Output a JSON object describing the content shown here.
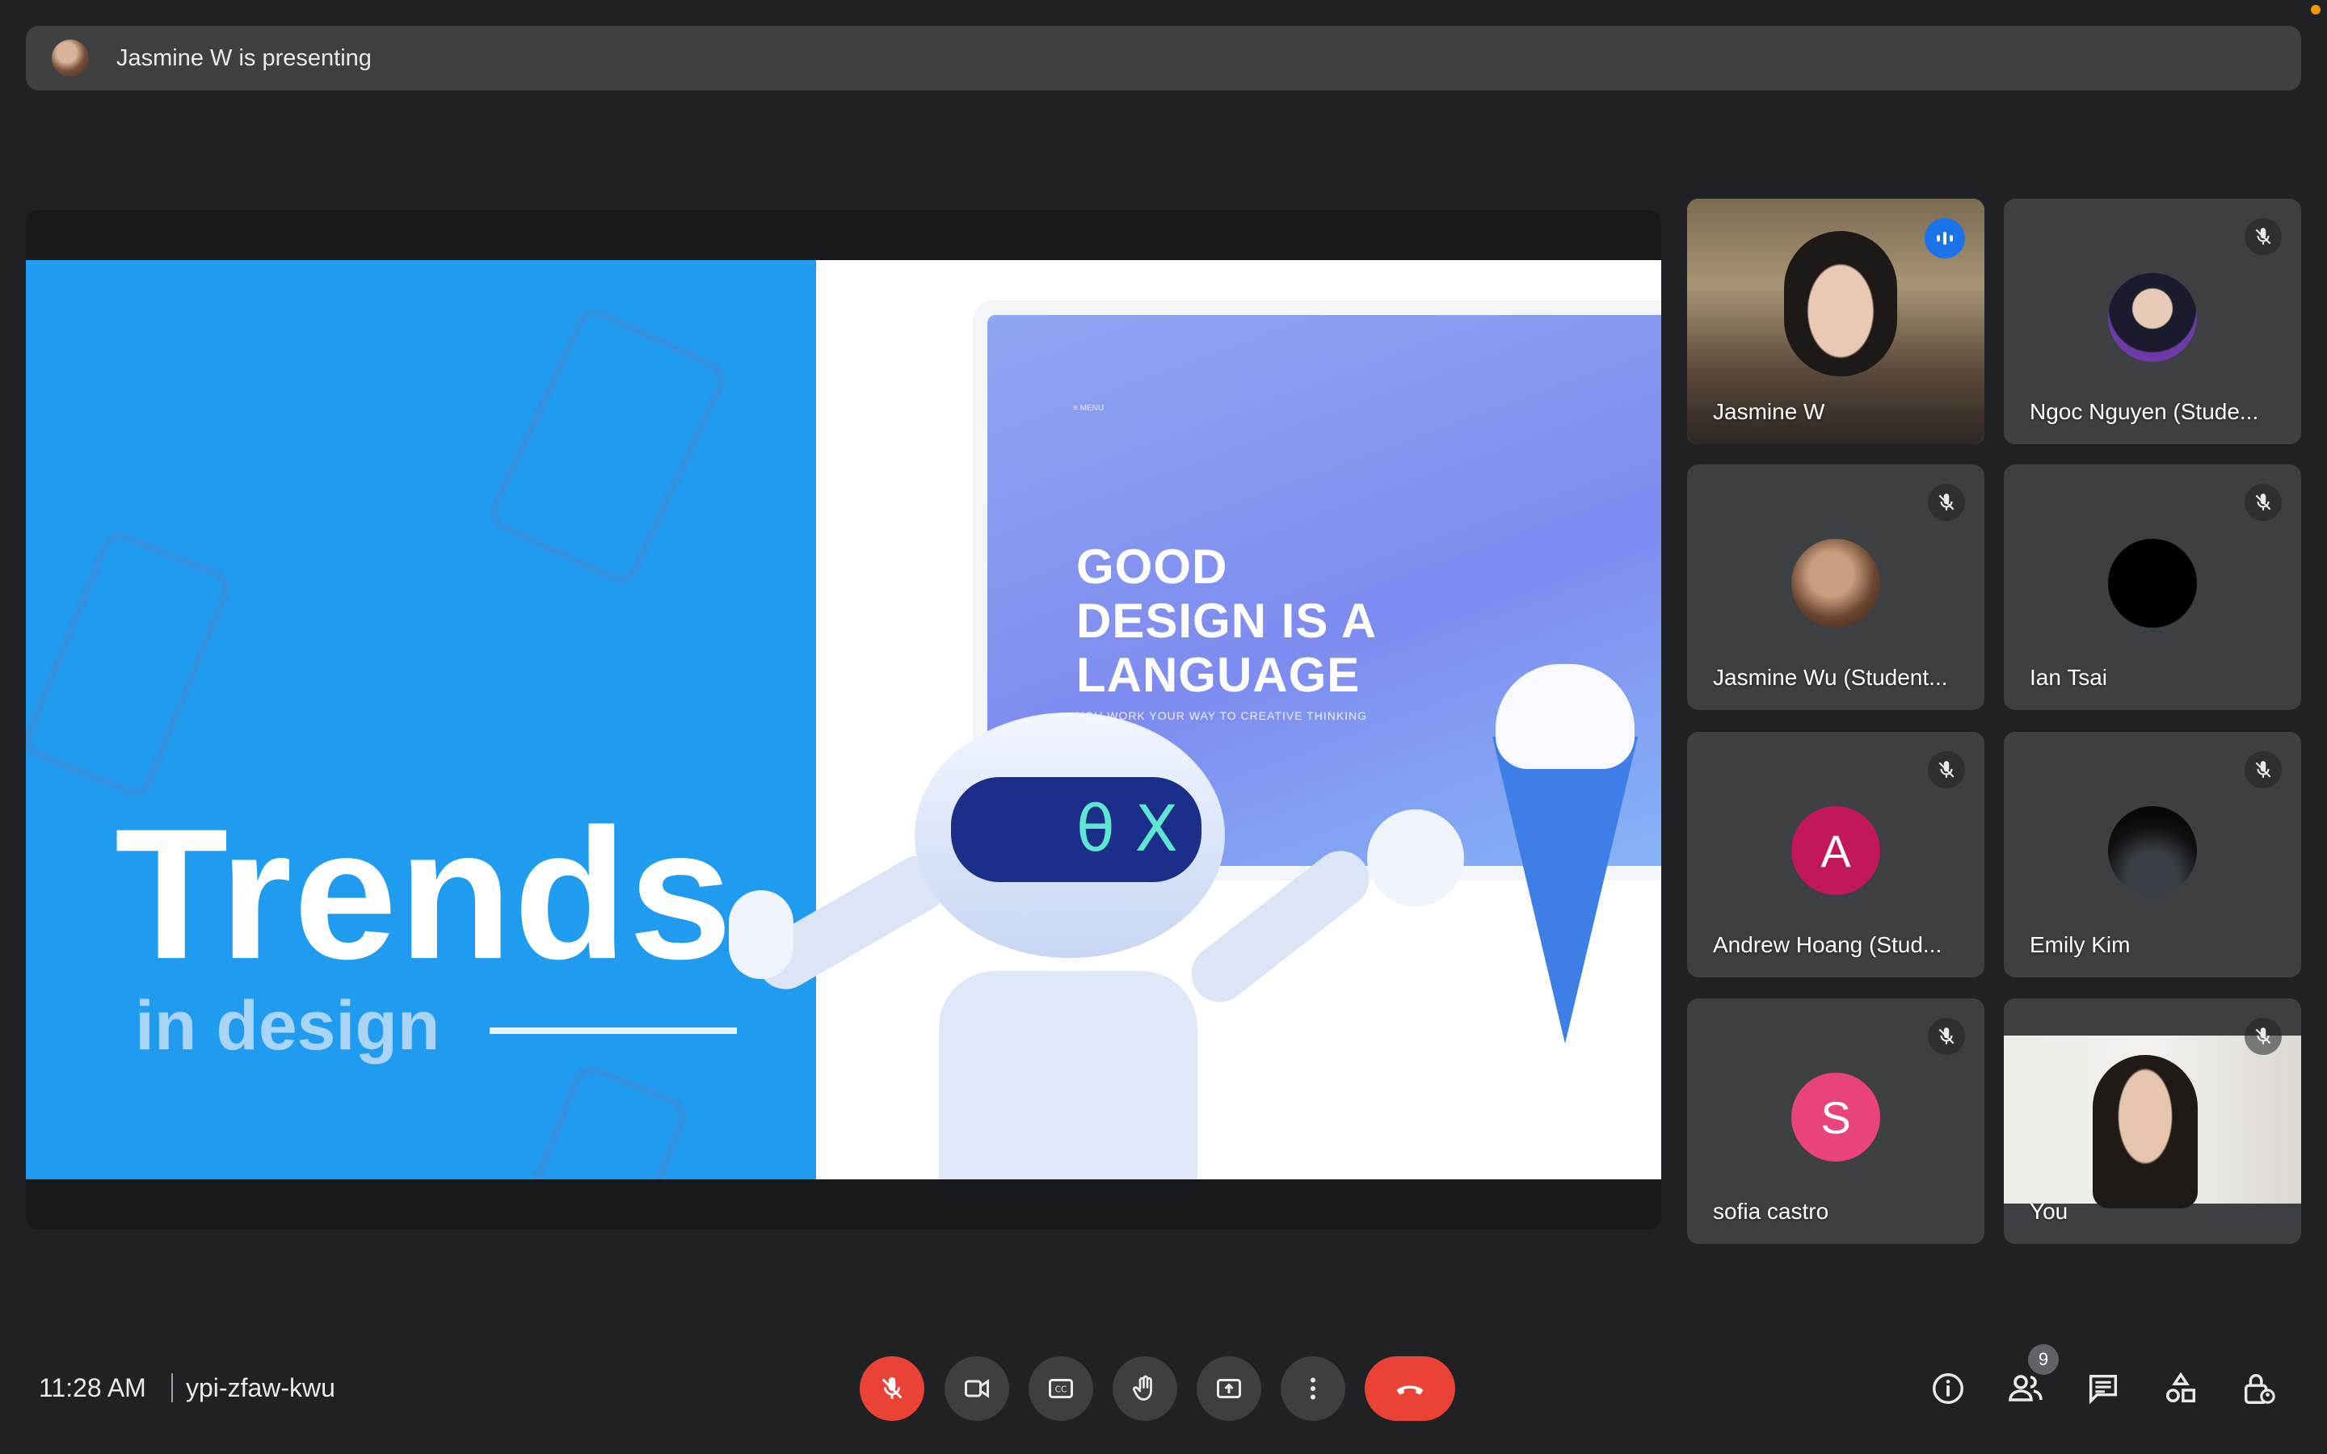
{
  "banner": {
    "text": "Jasmine W is presenting"
  },
  "slide": {
    "title": "Trends",
    "subtitle": "in design",
    "mock_menu": "≡ MENU",
    "mock_heading_lines": [
      "GOOD",
      "DESIGN IS A",
      "LANGUAGE"
    ],
    "mock_tagline": "YOU WORK YOUR WAY TO CREATIVE THINKING",
    "robot_eyes": "θ X",
    "colors": {
      "left_bg": "#1f9bf0",
      "screen": "#8fa6f1"
    }
  },
  "participants": [
    {
      "name": "Jasmine W",
      "speaking": true,
      "muted": false,
      "kind": "video"
    },
    {
      "name": "Ngoc Nguyen (Stude...",
      "speaking": false,
      "muted": true,
      "kind": "photo"
    },
    {
      "name": "Jasmine Wu (Student...",
      "speaking": false,
      "muted": true,
      "kind": "photo"
    },
    {
      "name": "Ian Tsai",
      "speaking": false,
      "muted": true,
      "kind": "photo"
    },
    {
      "name": "Andrew Hoang (Stud...",
      "speaking": false,
      "muted": true,
      "kind": "letter",
      "initial": "A",
      "color": "#c2185b"
    },
    {
      "name": "Emily Kim",
      "speaking": false,
      "muted": true,
      "kind": "photo"
    },
    {
      "name": "sofia castro",
      "speaking": false,
      "muted": true,
      "kind": "letter",
      "initial": "S",
      "color": "#e8437a"
    },
    {
      "name": "You",
      "speaking": false,
      "muted": true,
      "kind": "video"
    }
  ],
  "bottom_bar": {
    "time": "11:28 AM",
    "meeting_code": "ypi-zfaw-kwu",
    "controls": [
      "mic-muted-icon",
      "camera-icon",
      "captions-icon",
      "raise-hand-icon",
      "present-icon",
      "more-options-icon",
      "end-call-icon"
    ],
    "right_controls": [
      "info-icon",
      "people-icon",
      "chat-icon",
      "activities-icon",
      "host-controls-icon"
    ],
    "people_count": "9"
  }
}
